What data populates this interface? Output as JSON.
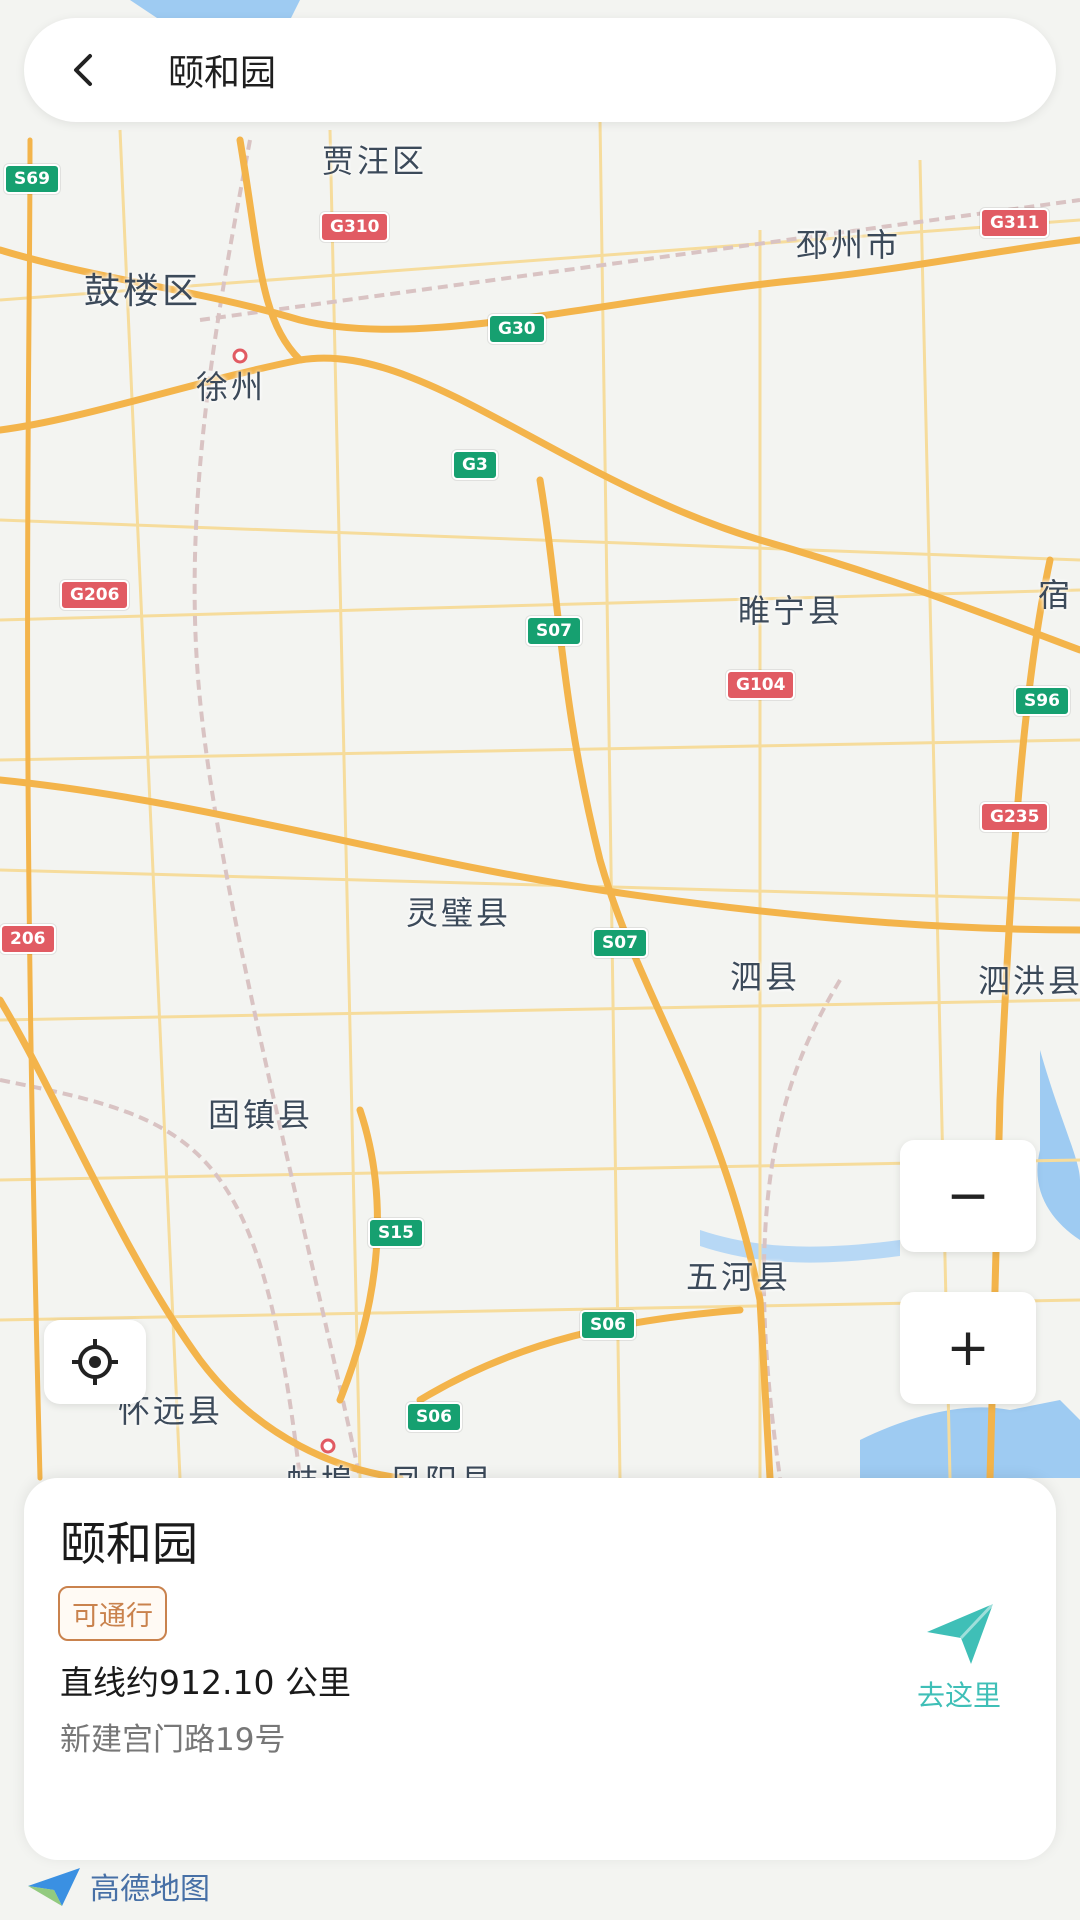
{
  "topbar": {
    "title": "颐和园"
  },
  "map": {
    "places": [
      {
        "id": "jiawang",
        "label": "贾汪区"
      },
      {
        "id": "pizhou",
        "label": "邳州市"
      },
      {
        "id": "gulou",
        "label": "鼓楼区"
      },
      {
        "id": "xuzhou",
        "label": "徐州"
      },
      {
        "id": "suining",
        "label": "睢宁县"
      },
      {
        "id": "su",
        "label": "宿"
      },
      {
        "id": "lingbi",
        "label": "灵璧县"
      },
      {
        "id": "sixian",
        "label": "泗县"
      },
      {
        "id": "sihong",
        "label": "泗洪县"
      },
      {
        "id": "guzhen",
        "label": "固镇县"
      },
      {
        "id": "wuhe",
        "label": "五河县"
      },
      {
        "id": "huaiyuan",
        "label": "怀远县"
      },
      {
        "id": "bengbu",
        "label": "蚌埠"
      },
      {
        "id": "fengyang",
        "label": "凤阳县"
      }
    ],
    "shields": [
      {
        "label": "S69"
      },
      {
        "label": "G310"
      },
      {
        "label": "G311"
      },
      {
        "label": "G30"
      },
      {
        "label": "G3"
      },
      {
        "label": "G206"
      },
      {
        "label": "S07"
      },
      {
        "label": "G104"
      },
      {
        "label": "S96"
      },
      {
        "label": "G235"
      },
      {
        "label": "206"
      },
      {
        "label": "S07"
      },
      {
        "label": "S15"
      },
      {
        "label": "S06"
      },
      {
        "label": "S06"
      }
    ]
  },
  "controls": {
    "zoom_out": "−",
    "zoom_in": "+"
  },
  "card": {
    "title": "颐和园",
    "badge": "可通行",
    "distance": "直线约912.10 公里",
    "address": "新建宫门路19号",
    "nav_label": "去这里"
  },
  "logo": {
    "text": "高德地图"
  },
  "colors": {
    "accent": "#3fbfb7",
    "badge": "#c9824d",
    "highway_red": "#e15b63",
    "highway_green": "#16a070",
    "road": "#f3b44b"
  }
}
